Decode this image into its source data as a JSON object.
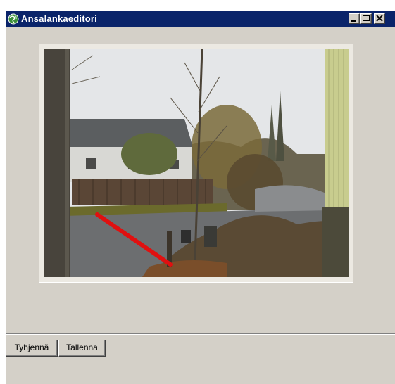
{
  "window": {
    "title": "Ansalankaeditori",
    "icon": "globe-icon",
    "titlebar_color": "#0a246a",
    "face_color": "#d4d0c8"
  },
  "caption_buttons": {
    "minimize_icon": "minimize-icon",
    "maximize_icon": "maximize-icon",
    "close_icon": "close-icon"
  },
  "image": {
    "content": "camera-snapshot",
    "overlay_line_color": "#e01010"
  },
  "toolbar": {
    "clear_label": "Tyhjennä",
    "save_label": "Tallenna"
  }
}
